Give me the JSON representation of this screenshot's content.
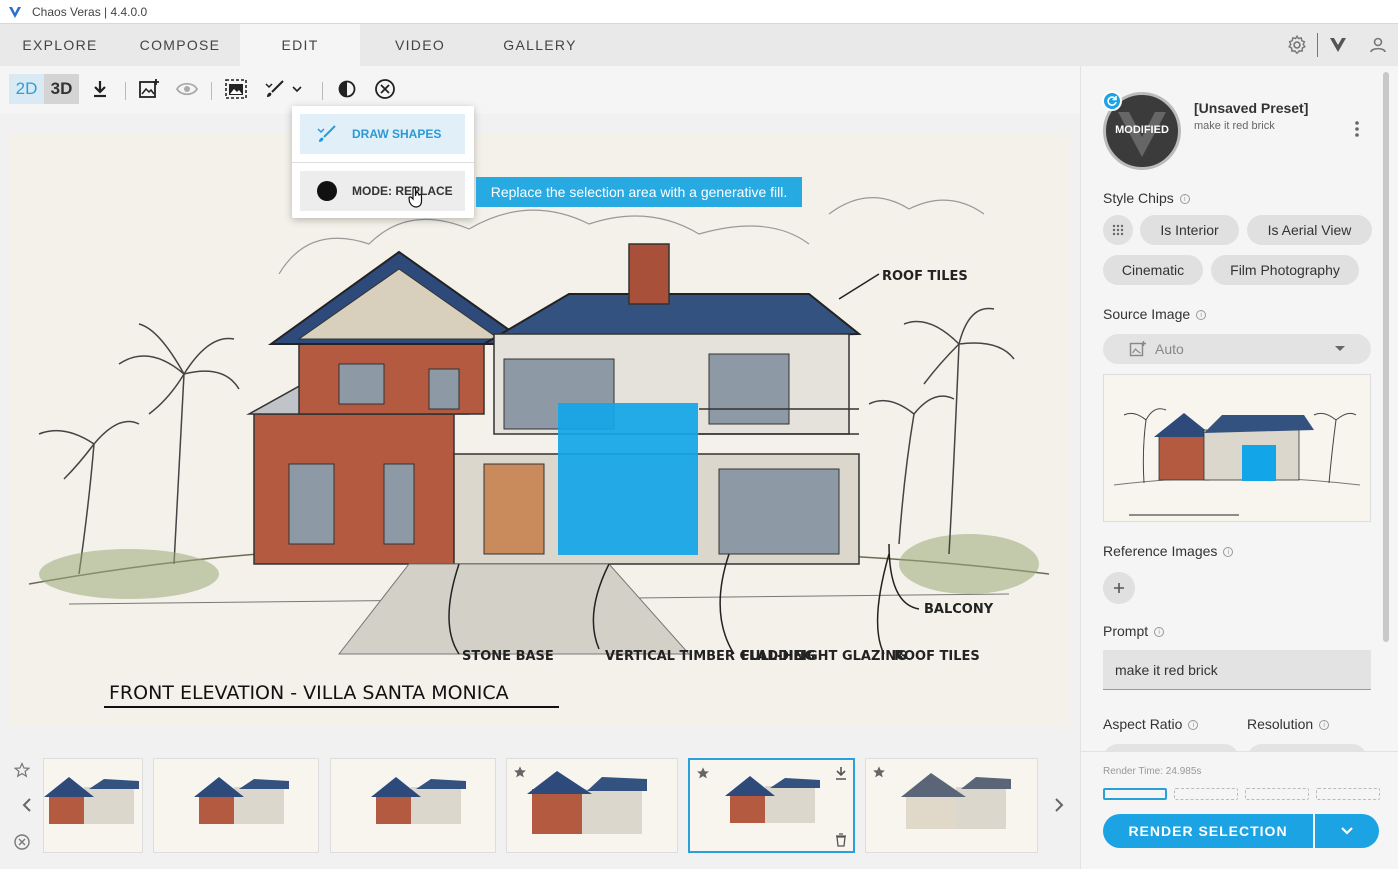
{
  "window": {
    "title": "Chaos Veras | 4.4.0.0"
  },
  "nav": {
    "tabs": [
      {
        "label": "EXPLORE"
      },
      {
        "label": "COMPOSE"
      },
      {
        "label": "EDIT"
      },
      {
        "label": "VIDEO"
      },
      {
        "label": "GALLERY"
      }
    ],
    "active_tab": "EDIT"
  },
  "toolbar": {
    "mode_2d": "2D",
    "mode_3d": "3D",
    "active_mode": "2D"
  },
  "dropdown": {
    "draw_shapes": "DRAW SHAPES",
    "mode": "MODE: REPLACE"
  },
  "tooltip": {
    "text": "Replace the selection area with a generative fill."
  },
  "sketch": {
    "title": "FRONT ELEVATION - VILLA SANTA MONICA",
    "labels": [
      "ROOF TILES",
      "BALCONY",
      "ROOF TILES",
      "FULL-HEIGHT GLAZING",
      "VERTICAL TIMBER CLADDING",
      "STONE BASE"
    ]
  },
  "preset": {
    "badge": "MODIFIED",
    "name": "[Unsaved Preset]",
    "subtitle": "make it red brick"
  },
  "style_chips": {
    "label": "Style Chips",
    "chips": [
      "Is Interior",
      "Is Aerial View",
      "Cinematic",
      "Film Photography"
    ]
  },
  "source_image": {
    "label": "Source Image",
    "value": "Auto"
  },
  "reference_images": {
    "label": "Reference Images"
  },
  "prompt": {
    "label": "Prompt",
    "value": "make it red brick"
  },
  "aspect_ratio": {
    "label": "Aspect Ratio"
  },
  "resolution": {
    "label": "Resolution"
  },
  "render": {
    "time": "Render Time: 24.985s",
    "button": "RENDER SELECTION"
  },
  "colors": {
    "accent": "#1ba3e3",
    "mask": "#12a6e8"
  }
}
